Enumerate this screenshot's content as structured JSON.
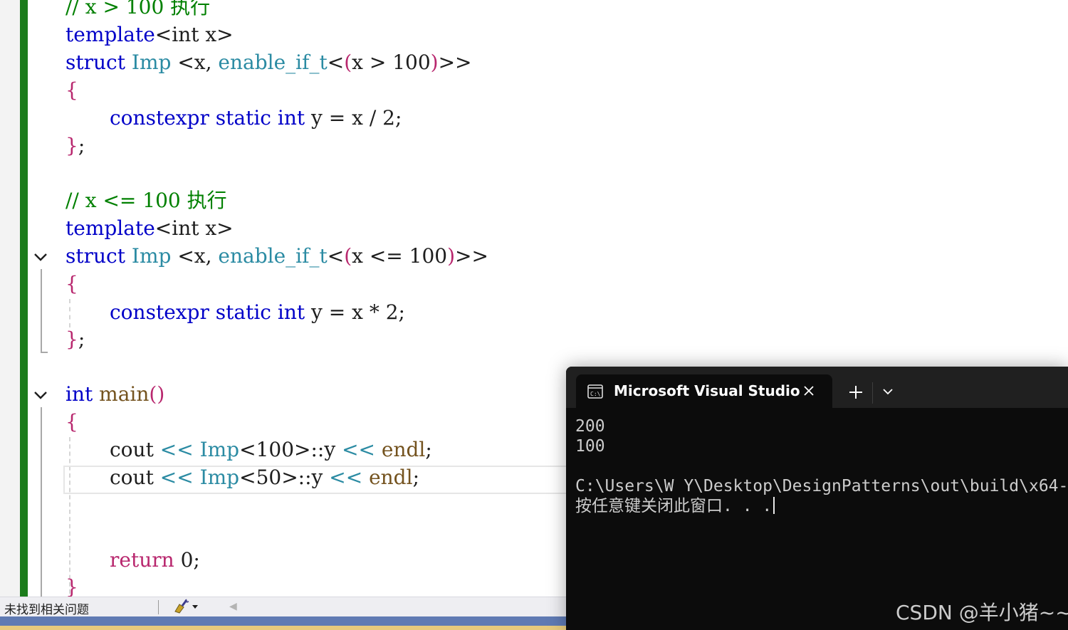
{
  "editor": {
    "lines": {
      "l1": "// x > 100 执行",
      "l2_kw": "template",
      "l2_rest": "<int x>",
      "l3_struct": "struct",
      "l3_imp": "Imp",
      "l3_mid": "<x, ",
      "l3_enable": "enable_if_t",
      "l3_lt": "<",
      "l3_lp": "(",
      "l3_cond": "x > 100",
      "l3_rp": ")",
      "l3_end": ">>",
      "l4": "{",
      "l5_a": "constexpr",
      "l5_b": "static",
      "l5_c": "int",
      "l5_d": "y = x / 2;",
      "l6_brace": "}",
      "l6_semi": ";",
      "l7": "// x <= 100 执行",
      "l8_kw": "template",
      "l8_rest": "<int x>",
      "l9_struct": "struct",
      "l9_imp": "Imp",
      "l9_mid": "<x, ",
      "l9_enable": "enable_if_t",
      "l9_lt": "<",
      "l9_lp": "(",
      "l9_cond": "x <= 100",
      "l9_rp": ")",
      "l9_end": ">>",
      "l10": "{",
      "l11_a": "constexpr",
      "l11_b": "static",
      "l11_c": "int",
      "l11_d": "y = x * 2;",
      "l12_brace": "}",
      "l12_semi": ";",
      "l13_int": "int",
      "l13_main": "main",
      "l13_parens": "()",
      "l14": "{",
      "l15_cout": "cout ",
      "l15_op1": "<<",
      "l15_imp": "Imp",
      "l15_arg": "<100>::y ",
      "l15_op2": "<<",
      "l15_endl": "endl",
      "l15_semi": ";",
      "l16_cout": "cout ",
      "l16_op1": "<<",
      "l16_imp": "Imp",
      "l16_arg": "<50>::y ",
      "l16_op2": "<<",
      "l16_endl": "endl",
      "l16_semi": ";",
      "l17_return": "return",
      "l17_rest": " 0;",
      "l18": "}"
    },
    "colors": {
      "keyword": "#0000c8",
      "type": "#2b8ba3",
      "function": "#74531f",
      "comment": "#008000",
      "brace": "#b8276e",
      "change_bar": "#1c7c1c"
    }
  },
  "statusbar": {
    "issues": "未找到相关问题"
  },
  "console": {
    "tab_title": "Microsoft Visual Studio",
    "output": {
      "line1": "200",
      "line2": "100",
      "line3": "C:\\Users\\W Y\\Desktop\\DesignPatterns\\out\\build\\x64-",
      "line4": "按任意键关闭此窗口. . ."
    },
    "icons": {
      "tab": "console-icon",
      "close": "close-icon",
      "new_tab": "plus-icon",
      "dropdown": "chevron-down-icon"
    }
  },
  "watermark": "CSDN @羊小猪~~"
}
